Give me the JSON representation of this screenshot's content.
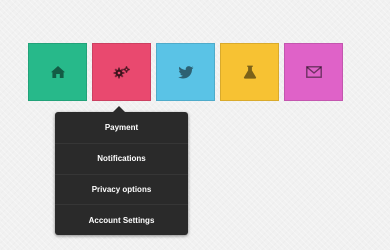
{
  "tiles": [
    {
      "name": "home",
      "icon": "home-icon",
      "color": "#27b98a"
    },
    {
      "name": "settings",
      "icon": "gears-icon",
      "color": "#e9496f"
    },
    {
      "name": "twitter",
      "icon": "twitter-bird-icon",
      "color": "#5ac3e6"
    },
    {
      "name": "lab",
      "icon": "flask-icon",
      "color": "#f7c233"
    },
    {
      "name": "mail",
      "icon": "envelope-icon",
      "color": "#df62c8"
    }
  ],
  "dropdown": {
    "background": "#2a2a2a",
    "items": [
      {
        "label": "Payment"
      },
      {
        "label": "Notifications"
      },
      {
        "label": "Privacy options"
      },
      {
        "label": "Account Settings"
      }
    ]
  }
}
